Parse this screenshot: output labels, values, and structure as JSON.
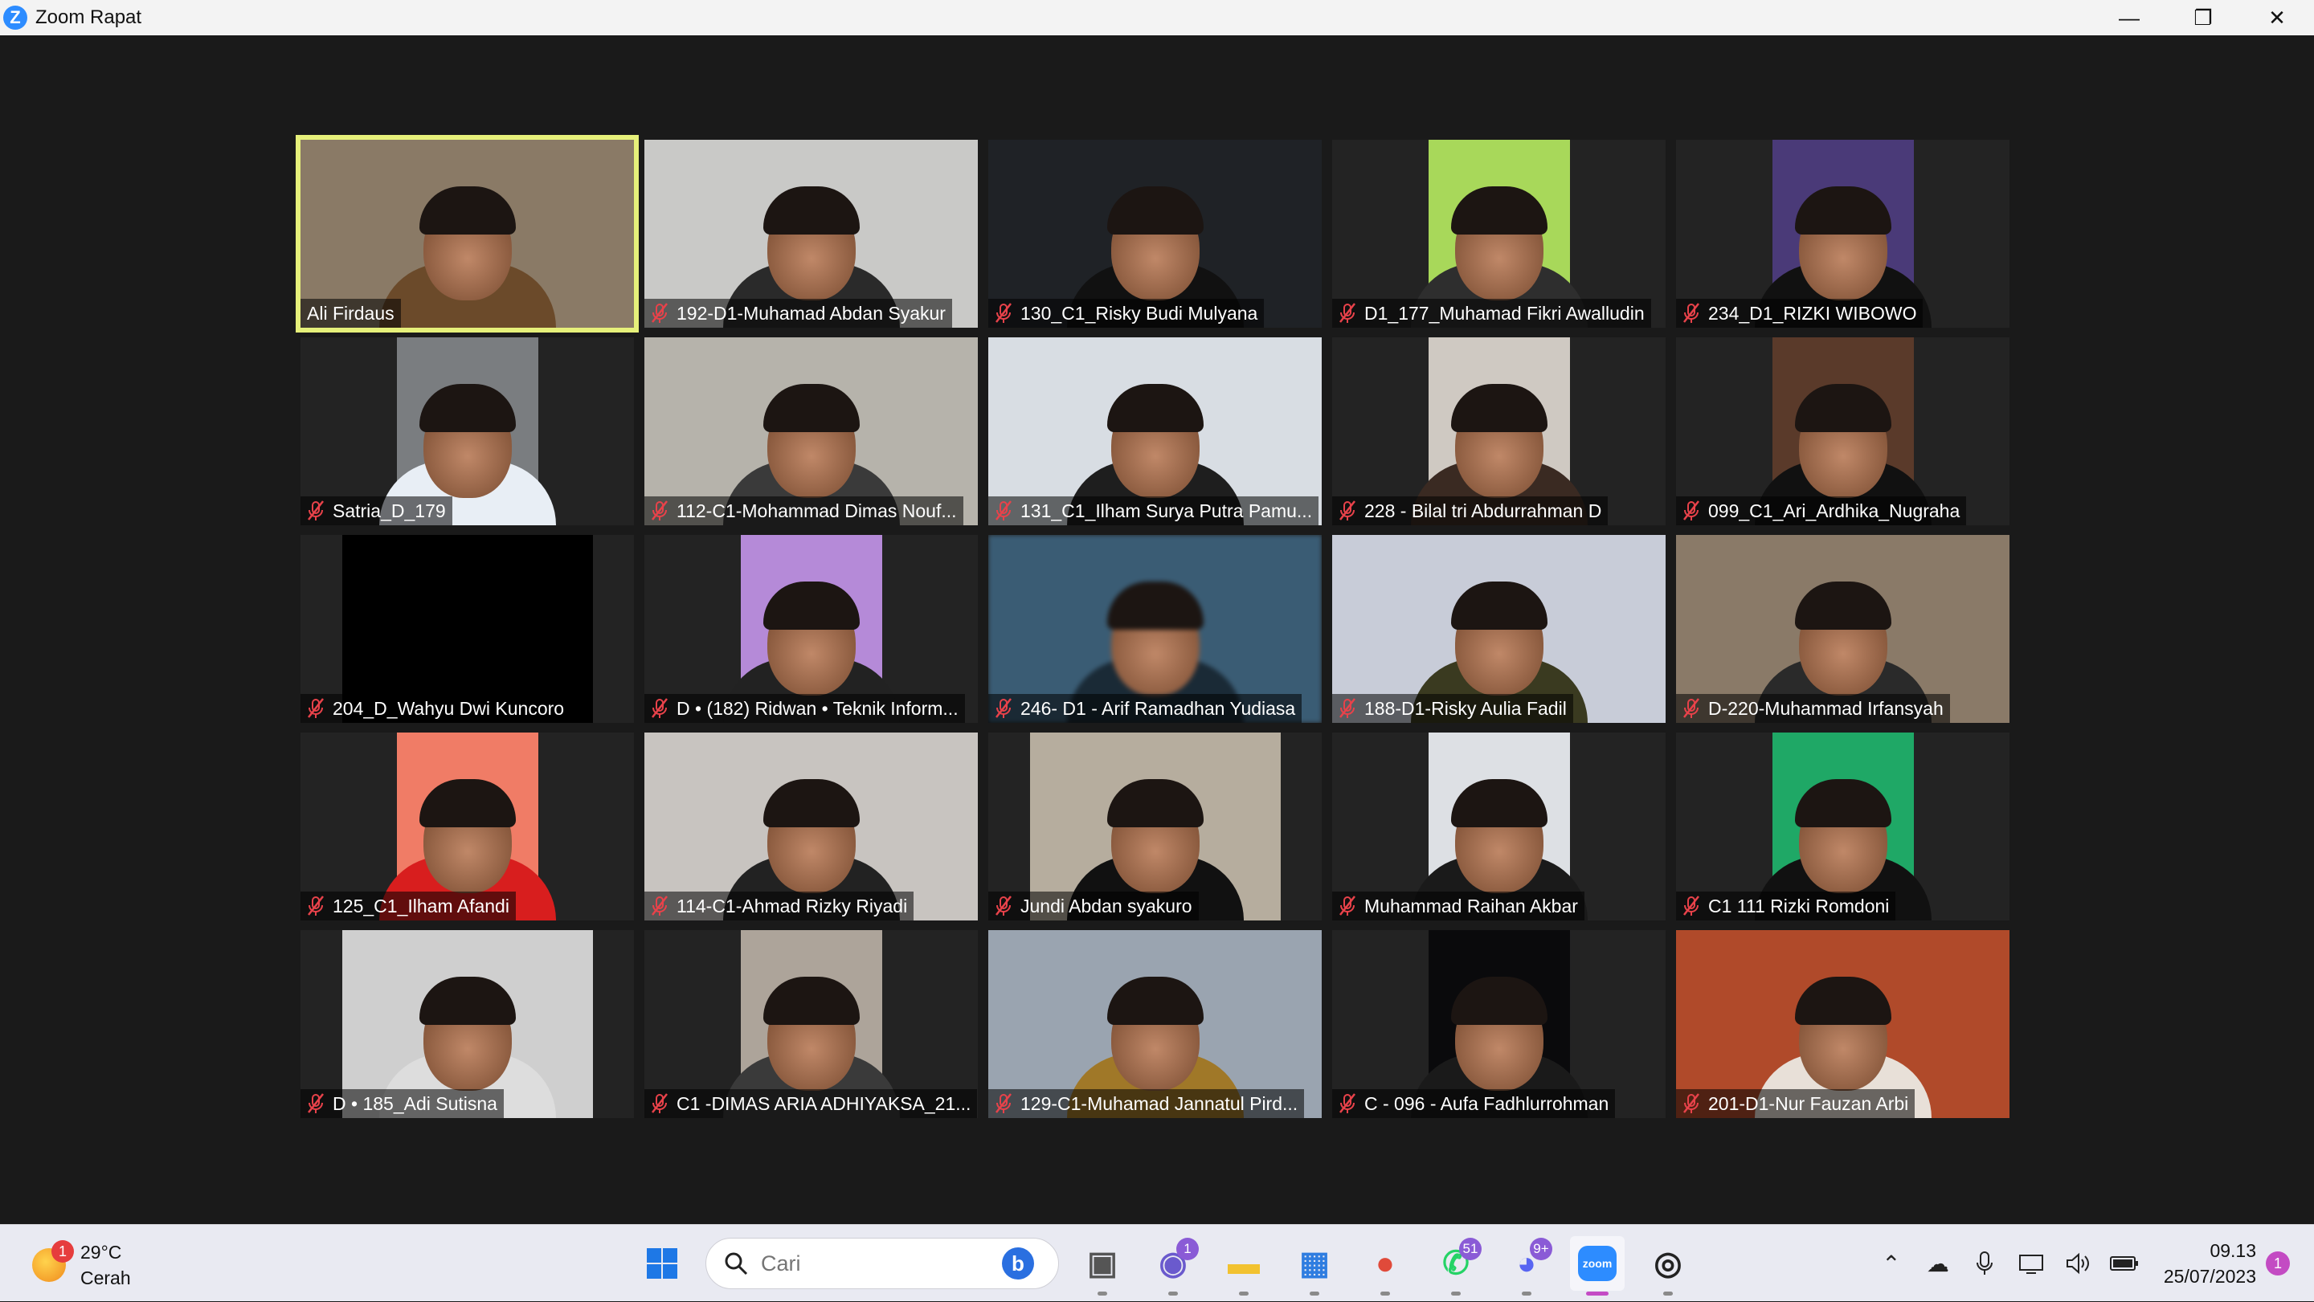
{
  "window": {
    "title": "Zoom Rapat",
    "controls": {
      "minimize": "—",
      "restore": "❐",
      "close": "✕"
    }
  },
  "participants": [
    {
      "name": "Ali Firdaus",
      "muted": false,
      "active": true,
      "bg": "#8a7a66",
      "shirt": "#6b4a2a",
      "video": "full"
    },
    {
      "name": "192-D1-Muhamad Abdan Syakur",
      "muted": true,
      "bg": "#c9c9c7",
      "shirt": "#2a2a2a",
      "video": "full"
    },
    {
      "name": "130_C1_Risky Budi Mulyana",
      "muted": true,
      "bg": "#1f2226",
      "shirt": "#111",
      "video": "full"
    },
    {
      "name": "D1_177_Muhamad Fikri Awalludin",
      "muted": true,
      "bg": "#a8d85a",
      "shirt": "#2e2e2e",
      "video": "narrow"
    },
    {
      "name": "234_D1_RIZKI WIBOWO",
      "muted": true,
      "bg": "#4a3a78",
      "shirt": "#111",
      "video": "narrow"
    },
    {
      "name": "Satria_D_179",
      "muted": true,
      "bg": "#7a7d80",
      "shirt": "#e8eef5",
      "video": "narrow"
    },
    {
      "name": "112-C1-Mohammad Dimas Nouf...",
      "muted": true,
      "bg": "#b6b3ab",
      "shirt": "#3a3a3a",
      "video": "full"
    },
    {
      "name": "131_C1_Ilham Surya Putra Pamu...",
      "muted": true,
      "bg": "#d8dde3",
      "shirt": "#1e1e1e",
      "video": "full"
    },
    {
      "name": "228 - Bilal tri Abdurrahman D",
      "muted": true,
      "bg": "#cfc9c2",
      "shirt": "#3a2a22",
      "video": "narrow"
    },
    {
      "name": "099_C1_Ari_Ardhika_Nugraha",
      "muted": true,
      "bg": "#5a3a2a",
      "shirt": "#111",
      "video": "narrow"
    },
    {
      "name": "204_D_Wahyu Dwi Kuncoro",
      "muted": true,
      "bg": "#000000",
      "shirt": "#000000",
      "video": "mid",
      "dark": true
    },
    {
      "name": "D • (182) Ridwan • Teknik Inform...",
      "muted": true,
      "bg": "#b58ad8",
      "shirt": "#222",
      "video": "narrow"
    },
    {
      "name": "246- D1 - Arif Ramadhan Yudiasa",
      "muted": true,
      "bg": "#3a5c74",
      "shirt": "#1a2a36",
      "video": "full",
      "blurred": true
    },
    {
      "name": "188-D1-Risky Aulia Fadil",
      "muted": true,
      "bg": "#c8ccd8",
      "shirt": "#3a3a20",
      "video": "full"
    },
    {
      "name": "D-220-Muhammad Irfansyah",
      "muted": true,
      "bg": "#8a7a68",
      "shirt": "#2a2a2a",
      "video": "full"
    },
    {
      "name": "125_C1_Ilham Afandi",
      "muted": true,
      "bg": "#f07c66",
      "shirt": "#d81e1e",
      "video": "narrow"
    },
    {
      "name": "114-C1-Ahmad Rizky Riyadi",
      "muted": true,
      "bg": "#c8c4c0",
      "shirt": "#222",
      "video": "full"
    },
    {
      "name": "Jundi Abdan syakuro",
      "muted": true,
      "bg": "#b6ad9e",
      "shirt": "#111",
      "video": "mid"
    },
    {
      "name": "Muhammad Raihan Akbar",
      "muted": true,
      "bg": "#dde0e4",
      "shirt": "#1a1a1a",
      "video": "narrow"
    },
    {
      "name": "C1 111 Rizki Romdoni",
      "muted": true,
      "bg": "#1fa866",
      "shirt": "#111",
      "video": "narrow"
    },
    {
      "name": "D • 185_Adi Sutisna",
      "muted": true,
      "bg": "#cfcfcf",
      "shirt": "#ddd",
      "video": "mid"
    },
    {
      "name": "C1 -DIMAS ARIA ADHIYAKSA_21...",
      "muted": true,
      "bg": "#ada49a",
      "shirt": "#3a3a3a",
      "video": "narrow"
    },
    {
      "name": "129-C1-Muhamad Jannatul Pird...",
      "muted": true,
      "bg": "#9aa4b0",
      "shirt": "#a07828",
      "video": "full"
    },
    {
      "name": "C - 096 - Aufa Fadhlurrohman",
      "muted": true,
      "bg": "#0a0a0c",
      "shirt": "#1a1a1a",
      "video": "narrow"
    },
    {
      "name": "201-D1-Nur Fauzan Arbi",
      "muted": true,
      "bg": "#b04a2a",
      "shirt": "#e8e0d8",
      "video": "full"
    }
  ],
  "taskbar": {
    "weather": {
      "temp": "29°C",
      "condition": "Cerah",
      "badge": "1"
    },
    "search": {
      "placeholder": "Cari"
    },
    "apps": [
      {
        "name": "start-button",
        "glyph": "⊞",
        "color": "#1e78e6"
      },
      {
        "name": "task-view",
        "glyph": "▣",
        "color": "#555"
      },
      {
        "name": "teams-chat",
        "glyph": "◉",
        "color": "#6a5acd",
        "badge": "1"
      },
      {
        "name": "file-explorer",
        "glyph": "▬",
        "color": "#f2c230"
      },
      {
        "name": "microsoft-store",
        "glyph": "▦",
        "color": "#2f7de0"
      },
      {
        "name": "chrome",
        "glyph": "●",
        "color": "#e04a3a"
      },
      {
        "name": "whatsapp",
        "glyph": "✆",
        "color": "#25d366",
        "badge": "51"
      },
      {
        "name": "discord",
        "glyph": "◕",
        "color": "#5865f2",
        "badge": "9+"
      },
      {
        "name": "zoom",
        "glyph": "zoom",
        "color": "#2d8cff",
        "active": true
      },
      {
        "name": "obs",
        "glyph": "◎",
        "color": "#222"
      }
    ],
    "tray": {
      "chevron": "⌃",
      "onedrive": "☁",
      "mic": "🎙",
      "network": "▭",
      "volume": "🔊",
      "battery": "▭"
    },
    "clock": {
      "time": "09.13",
      "date": "25/07/2023"
    },
    "notifications": "1"
  }
}
